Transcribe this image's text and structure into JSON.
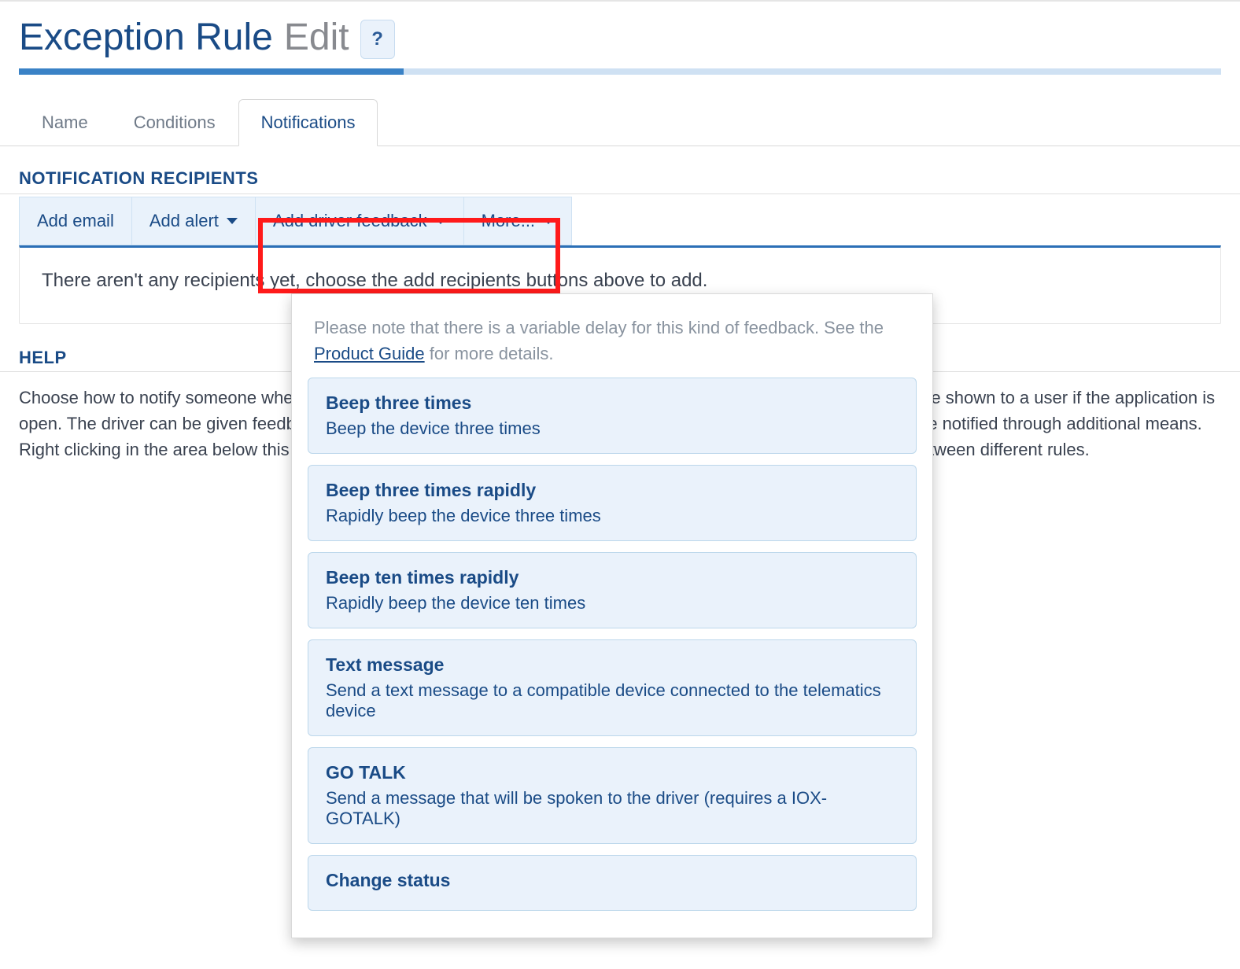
{
  "header": {
    "title": "Exception Rule",
    "subtitle": "Edit",
    "help_label": "?"
  },
  "tabs": [
    {
      "label": "Name"
    },
    {
      "label": "Conditions"
    },
    {
      "label": "Notifications"
    }
  ],
  "section_heading": "NOTIFICATION RECIPIENTS",
  "buttons": {
    "add_email": "Add email",
    "add_alert": "Add alert",
    "add_driver_feedback": "Add driver feedback",
    "more": "More..."
  },
  "recipients_empty": "There aren't any recipients yet, choose the add recipients buttons above to add.",
  "help": {
    "heading": "HELP",
    "body": "Choose how to notify someone when an exception is generated. Emails can be sent to users or a group. A popup can be shown to a user if the application is open. The driver can be given feedback by their telematics device, based on change is status. 3rd Party systems can be notified through additional means. Right clicking in the area below this button bar will open an advanced box allowing copying and pasting of recipients between different rules."
  },
  "dropdown": {
    "note_pre": "Please note that there is a variable delay for this kind of feedback. See the ",
    "note_link": "Product Guide",
    "note_post": " for more details.",
    "items": [
      {
        "title": "Beep three times",
        "desc": "Beep the device three times"
      },
      {
        "title": "Beep three times rapidly",
        "desc": "Rapidly beep the device three times"
      },
      {
        "title": "Beep ten times rapidly",
        "desc": "Rapidly beep the device ten times"
      },
      {
        "title": "Text message",
        "desc": "Send a text message to a compatible device connected to the telematics device"
      },
      {
        "title": "GO TALK",
        "desc": "Send a message that will be spoken to the driver (requires a IOX-GOTALK)"
      },
      {
        "title": "Change status",
        "desc": ""
      }
    ]
  }
}
